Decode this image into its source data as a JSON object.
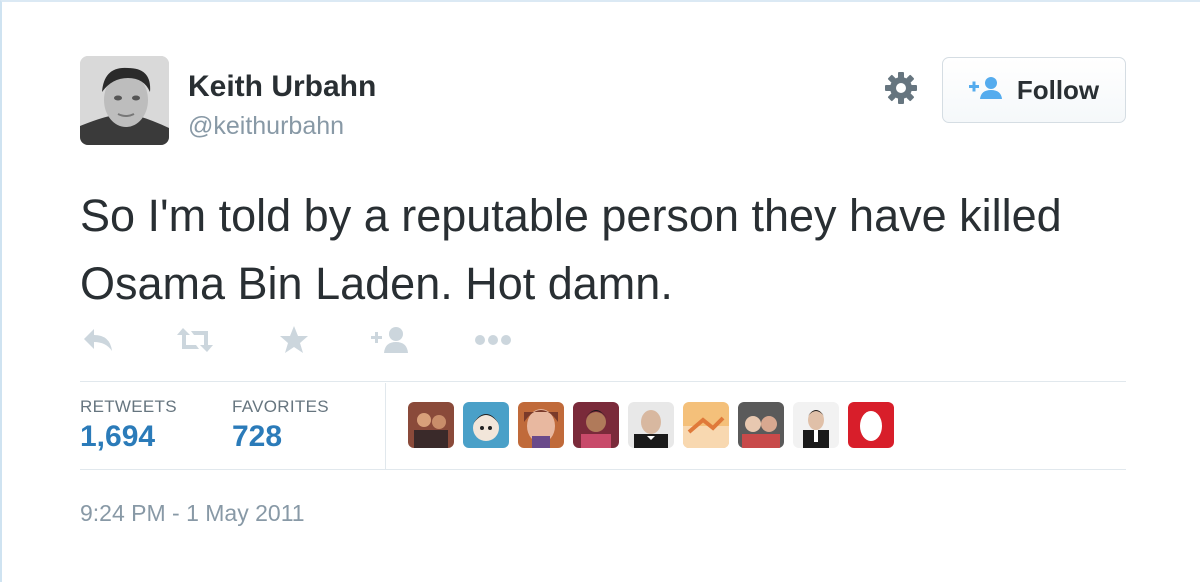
{
  "user": {
    "name": "Keith Urbahn",
    "handle": "@keithurbahn"
  },
  "follow_button": {
    "label": "Follow",
    "icon": "add-user-icon"
  },
  "settings": {
    "icon": "gear-icon"
  },
  "tweet": {
    "text": "So I'm told by a reputable person they have killed Osama Bin Laden. Hot damn."
  },
  "actions": [
    {
      "icon": "reply-icon"
    },
    {
      "icon": "retweet-icon"
    },
    {
      "icon": "favorite-star-icon"
    },
    {
      "icon": "follow-plus-icon"
    },
    {
      "icon": "more-dots-icon"
    }
  ],
  "stats": {
    "retweets_label": "RETWEETS",
    "retweets_value": "1,694",
    "favorites_label": "FAVORITES",
    "favorites_value": "728"
  },
  "favoriters": [
    {
      "icon": "user-avatar"
    },
    {
      "icon": "user-avatar"
    },
    {
      "icon": "user-avatar"
    },
    {
      "icon": "user-avatar"
    },
    {
      "icon": "user-avatar"
    },
    {
      "icon": "user-avatar"
    },
    {
      "icon": "user-avatar"
    },
    {
      "icon": "user-avatar"
    },
    {
      "icon": "user-avatar"
    }
  ],
  "timestamp": "9:24 PM - 1 May 2011",
  "colors": {
    "text": "#292f33",
    "muted": "#8899a6",
    "link": "#2b7bb9",
    "follow_icon": "#55acee",
    "action_icon": "#ccd6dd"
  }
}
